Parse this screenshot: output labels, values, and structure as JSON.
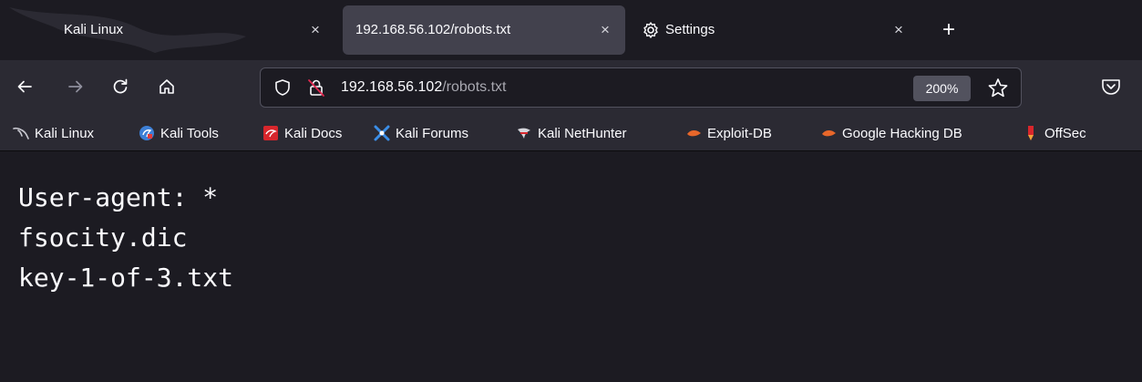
{
  "tabs": [
    {
      "title": "Kali Linux",
      "active": false
    },
    {
      "title": "192.168.56.102/robots.txt",
      "active": true
    },
    {
      "title": "Settings",
      "active": false
    }
  ],
  "tab_close_glyph": "×",
  "new_tab_glyph": "+",
  "url": {
    "host": "192.168.56.102",
    "path": "/robots.txt"
  },
  "zoom": "200%",
  "bookmarks": [
    {
      "label": "Kali Linux",
      "icon": "kali-dragon-icon"
    },
    {
      "label": "Kali Tools",
      "icon": "kali-tools-icon"
    },
    {
      "label": "Kali Docs",
      "icon": "kali-docs-icon"
    },
    {
      "label": "Kali Forums",
      "icon": "kali-forums-icon"
    },
    {
      "label": "Kali NetHunter",
      "icon": "kali-nethunter-icon"
    },
    {
      "label": "Exploit-DB",
      "icon": "exploit-db-icon"
    },
    {
      "label": "Google Hacking DB",
      "icon": "ghdb-icon"
    },
    {
      "label": "OffSec",
      "icon": "offsec-icon"
    }
  ],
  "content_lines": [
    "User-agent: *",
    "fsocity.dic",
    "key-1-of-3.txt"
  ],
  "colors": {
    "accent": "#fbfbfe",
    "background": "#1c1b22",
    "toolbar": "#2b2a33",
    "active_tab": "#42414d"
  }
}
